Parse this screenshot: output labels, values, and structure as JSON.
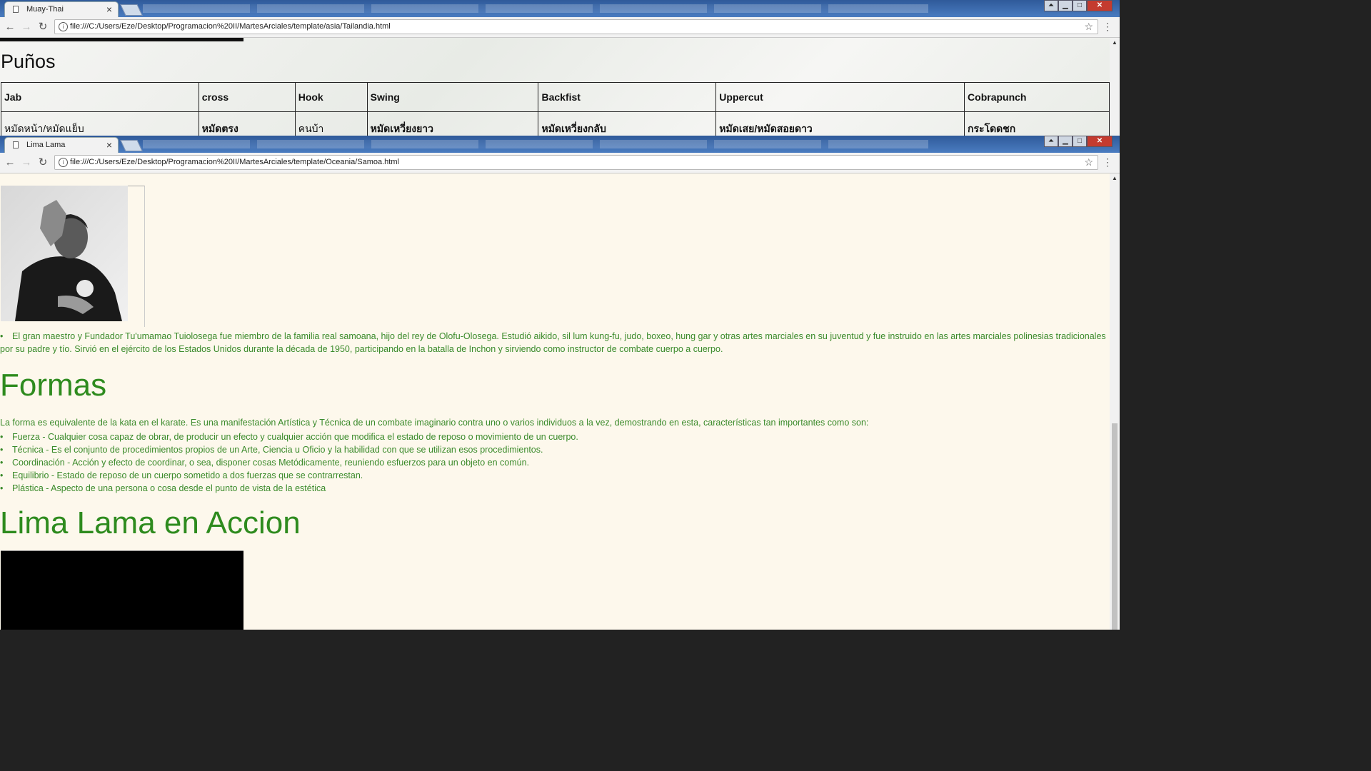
{
  "window1": {
    "tab_title": "Muay-Thai",
    "tab_close": "×",
    "url": "file:///C:/Users/Eze/Desktop/Programacion%20II/MartesArciales/template/asia/Tailandia.html",
    "heading": "Puños",
    "table": {
      "headers": [
        "Jab",
        "cross",
        "Hook",
        "Swing",
        "Backfist",
        "Uppercut",
        "Cobrapunch"
      ],
      "thai": [
        "หมัดหน้า/หมัดแย็บ",
        "หมัดตรง",
        "คนบ้า",
        "หมัดเหวี่ยงยาว",
        "หมัดเหวี่ยงกลับ",
        "หมัดเสย/หมัดสอยดาว",
        "กระโดดชก"
      ]
    }
  },
  "window2": {
    "tab_title": "Lima Lama",
    "tab_close": "×",
    "url": "file:///C:/Users/Eze/Desktop/Programacion%20II/MartesArciales/template/Oceania/Samoa.html",
    "bio": "El gran maestro y Fundador Tu'umamao Tuiolosega fue miembro de la familia real samoana, hijo del rey de Olofu-Olosega. Estudió aikido, sil lum kung-fu, judo, boxeo, hung gar y otras artes marciales en su juventud y fue instruido en las artes marciales polinesias tradicionales por su padre y tío. Sirvió en el ejército de los Estados Unidos durante la década de 1950, participando en la batalla de Inchon y sirviendo como instructor de combate cuerpo a cuerpo.",
    "formas_heading": "Formas",
    "formas_intro": "La forma es equivalente de la kata en el karate. Es una manifestación Artística y Técnica de un combate imaginario contra uno o varios individuos a la vez, demostrando en esta, características tan importantes como son:",
    "formas_items": [
      "Fuerza - Cualquier cosa capaz de obrar, de producir un efecto y cualquier acción que modifica el estado de reposo o movimiento de un cuerpo.",
      "Técnica - Es el conjunto de procedimientos propios de un Arte, Ciencia u Oficio y la habilidad con que se utilizan esos procedimientos.",
      "Coordinación - Acción y efecto de coordinar, o sea, disponer cosas Metódicamente, reuniendo esfuerzos para un objeto en común.",
      "Equilibrio - Estado de reposo de un cuerpo sometido a dos fuerzas que se contrarrestan.",
      "Plástica - Aspecto de una persona o cosa desde el punto de vista de la estética"
    ],
    "accion_heading": "Lima Lama en Accion"
  },
  "icons": {
    "back": "←",
    "forward": "→",
    "reload": "↻",
    "info": "i",
    "star": "☆",
    "menu": "⋮",
    "scroll_up": "▲",
    "min": "▁",
    "max": "□",
    "close": "✕",
    "user": "⏶"
  },
  "colors": {
    "content_green": "#3a8a2a",
    "page_bg": "#fdf8ec"
  }
}
